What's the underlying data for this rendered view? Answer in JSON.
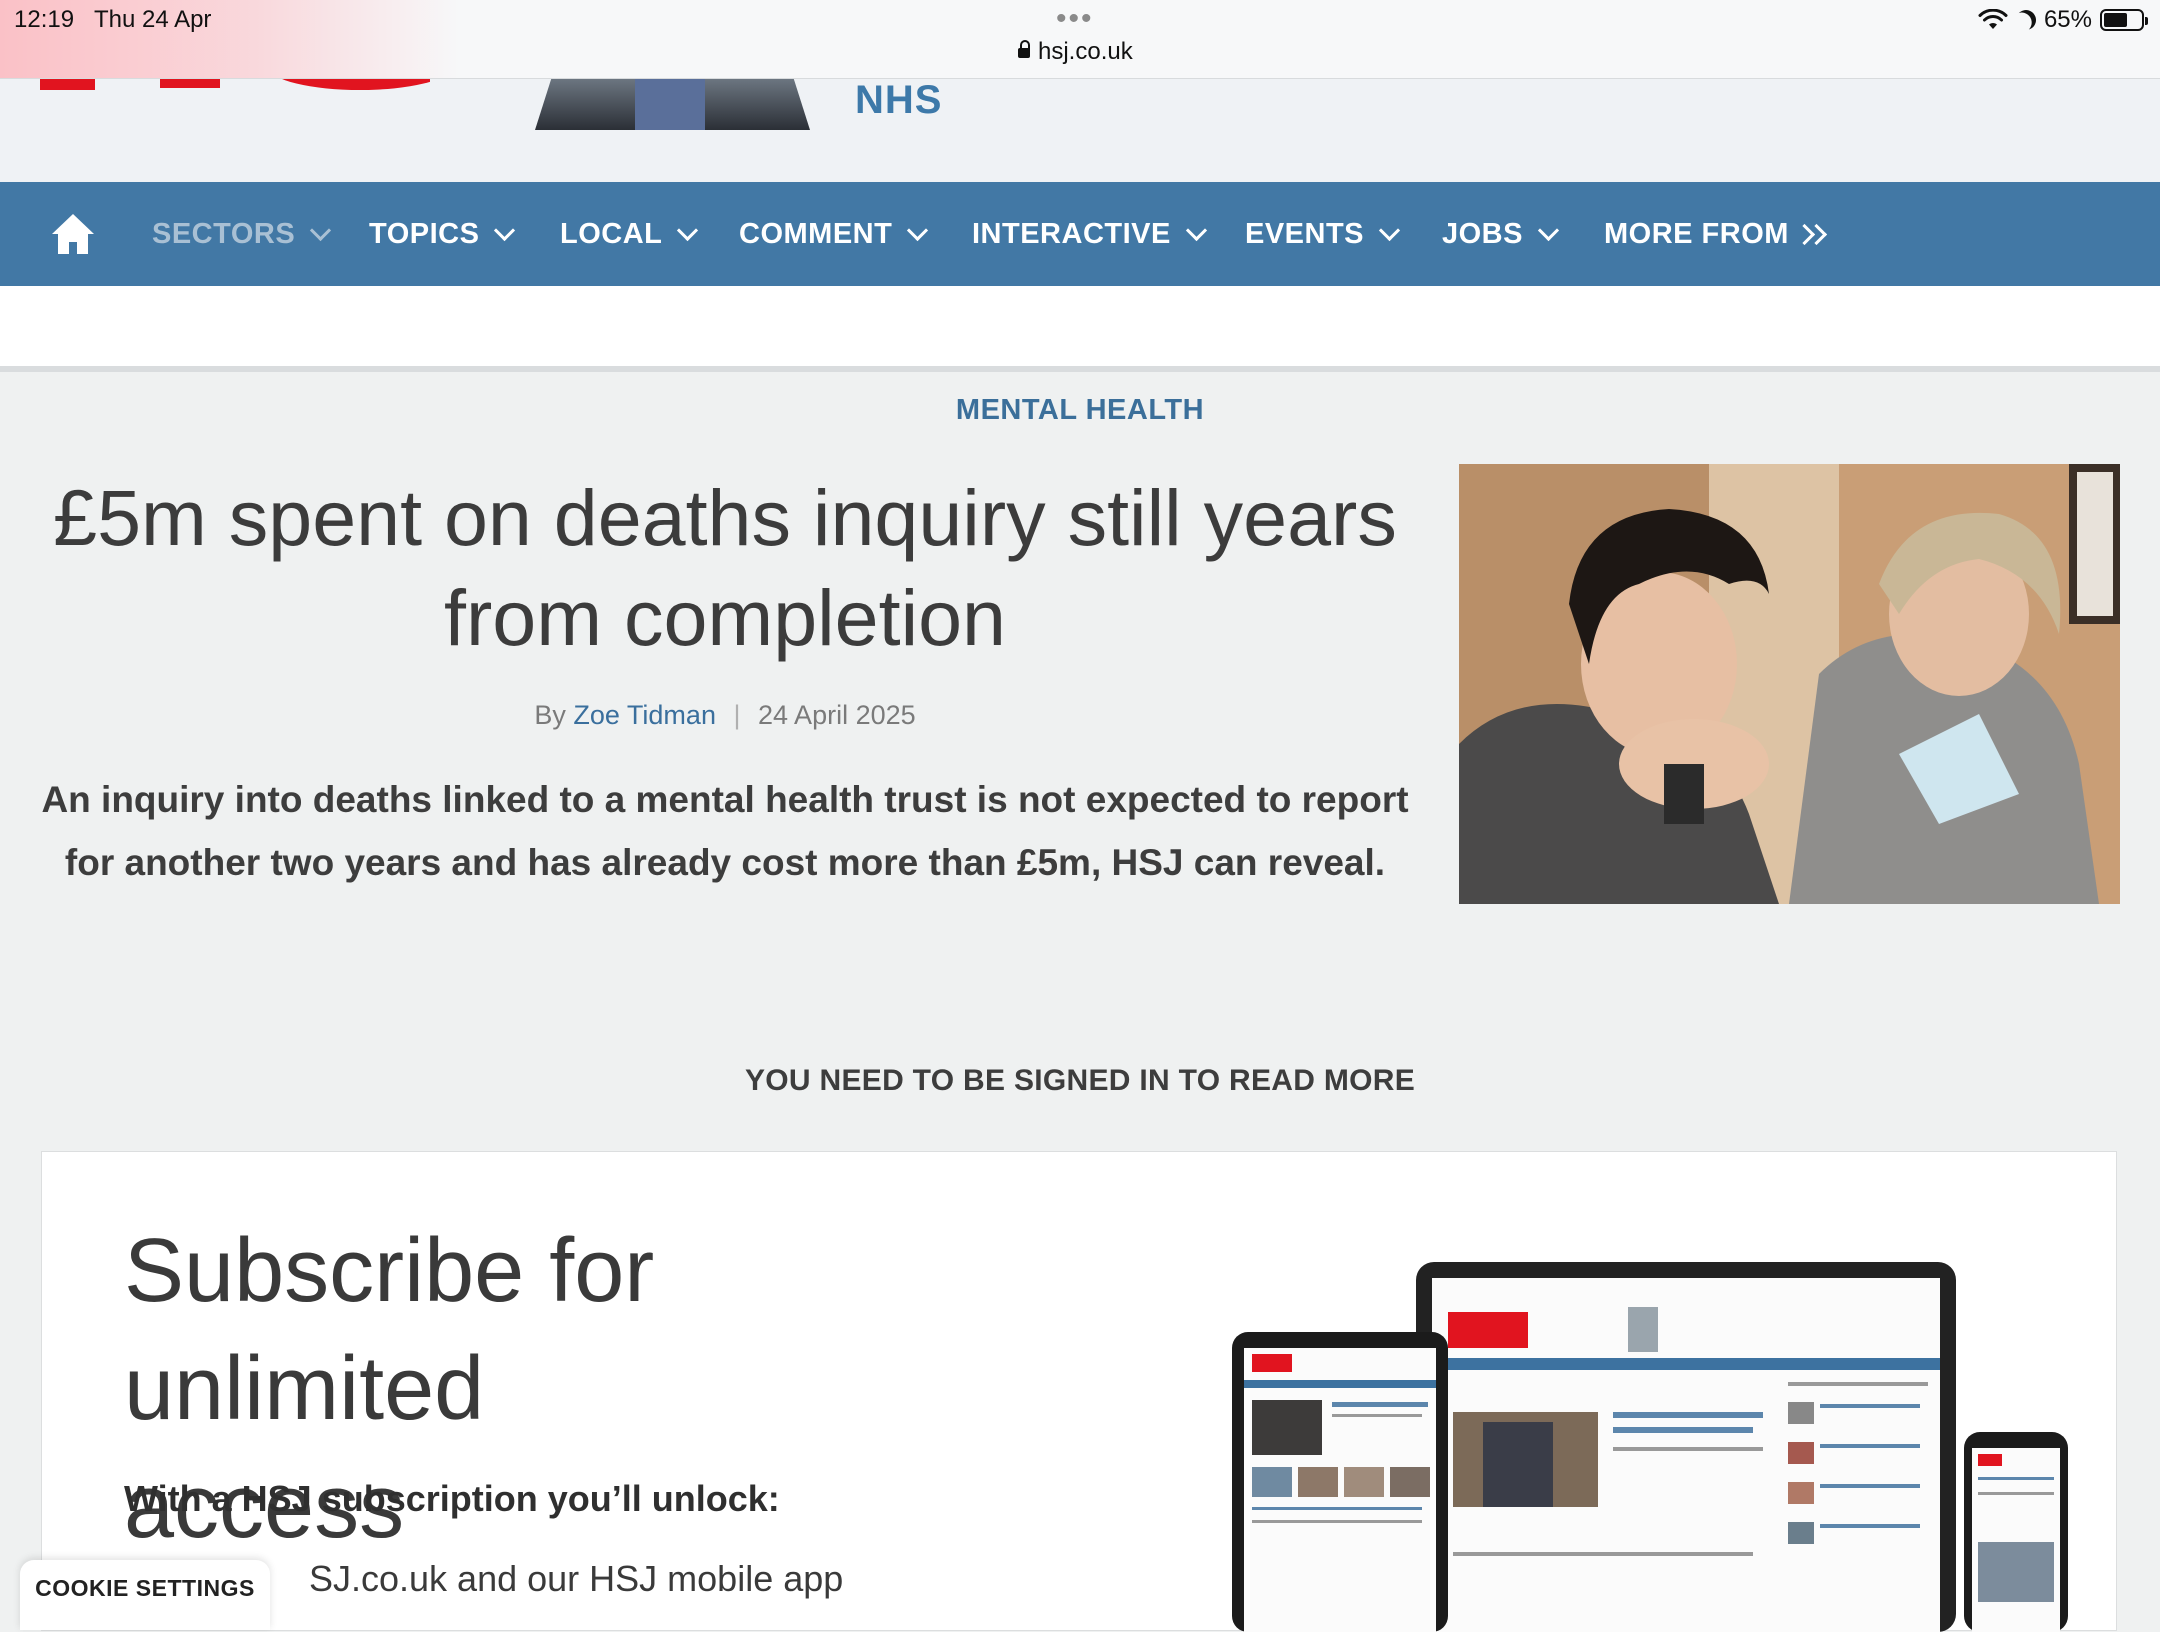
{
  "status_bar": {
    "time": "12:19",
    "date": "Thu 24 Apr",
    "dots": "•••",
    "url": "hsj.co.uk",
    "battery": "65%",
    "battery_level": 0.65
  },
  "header": {
    "promo_text": "NHS",
    "logo_color": "#e1141f"
  },
  "nav": {
    "background": "#4278a5",
    "items": [
      {
        "label": "SECTORS"
      },
      {
        "label": "TOPICS"
      },
      {
        "label": "LOCAL"
      },
      {
        "label": "COMMENT"
      },
      {
        "label": "INTERACTIVE"
      },
      {
        "label": "EVENTS"
      },
      {
        "label": "JOBS"
      },
      {
        "label": "MORE FROM"
      }
    ]
  },
  "article": {
    "kicker": "MENTAL HEALTH",
    "headline_line1": "£5m spent on deaths inquiry still years",
    "headline_line2": "from completion",
    "by": "By",
    "author": "Zoe Tidman",
    "separator": "|",
    "date": "24 April 2025",
    "standfirst_line1": "An inquiry into deaths linked to a mental health trust is not expected to report",
    "standfirst_line2": "for another two years and has already cost more than £5m, HSJ can reveal."
  },
  "paywall": {
    "notice": "YOU NEED TO BE SIGNED IN TO READ MORE",
    "title_line1": "Subscribe for unlimited",
    "title_line2": "access",
    "unlock_heading": "With a HSJ subscription you’ll unlock:",
    "first_item_visible": "SJ.co.uk and our HSJ mobile app"
  },
  "cookie": {
    "label": "COOKIE SETTINGS"
  }
}
